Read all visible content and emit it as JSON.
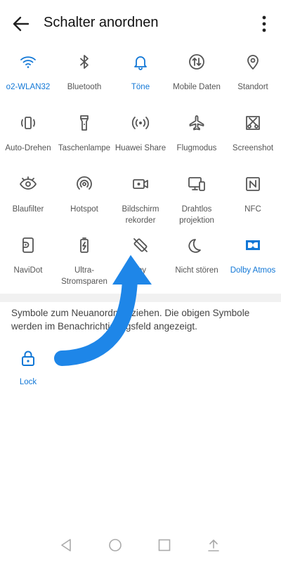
{
  "header": {
    "title": "Schalter anordnen"
  },
  "tiles": [
    {
      "label": "o2-WLAN32",
      "icon": "wifi-icon",
      "active": true
    },
    {
      "label": "Bluetooth",
      "icon": "bluetooth-icon",
      "active": false
    },
    {
      "label": "Töne",
      "icon": "bell-icon",
      "active": true
    },
    {
      "label": "Mobile Daten",
      "icon": "mobile-data-icon",
      "active": false
    },
    {
      "label": "Standort",
      "icon": "location-pin-icon",
      "active": false
    },
    {
      "label": "Auto-Drehen",
      "icon": "auto-rotate-icon",
      "active": false
    },
    {
      "label": "Taschenlampe",
      "icon": "flashlight-icon",
      "active": false
    },
    {
      "label": "Huawei Share",
      "icon": "huawei-share-icon",
      "active": false
    },
    {
      "label": "Flugmodus",
      "icon": "airplane-icon",
      "active": false
    },
    {
      "label": "Screenshot",
      "icon": "screenshot-icon",
      "active": false
    },
    {
      "label": "Blaufilter",
      "icon": "eye-icon",
      "active": false
    },
    {
      "label": "Hotspot",
      "icon": "hotspot-icon",
      "active": false
    },
    {
      "label": "Bildschirm rekorder",
      "icon": "screen-recorder-icon",
      "active": false
    },
    {
      "label": "Drahtlos projektion",
      "icon": "wireless-projection-icon",
      "active": false
    },
    {
      "label": "NFC",
      "icon": "nfc-icon",
      "active": false
    },
    {
      "label": "NaviDot",
      "icon": "navidot-icon",
      "active": false
    },
    {
      "label": "Ultra-Stromsparen",
      "icon": "battery-icon",
      "active": false
    },
    {
      "label": "rby",
      "icon": "rotate-lock-icon",
      "active": false
    },
    {
      "label": "Nicht stören",
      "icon": "moon-icon",
      "active": false
    },
    {
      "label": "Dolby Atmos",
      "icon": "dolby-icon",
      "active": true
    }
  ],
  "info": {
    "text": "Symbole zum Neuanordnen ziehen. Die obigen Symbole werden im Benachrichtigungsfeld angezeigt."
  },
  "extra": {
    "lock_label": "Lock"
  },
  "colors": {
    "accent": "#1177d6",
    "icon_gray": "#555555",
    "arrow": "#1e86e8"
  }
}
